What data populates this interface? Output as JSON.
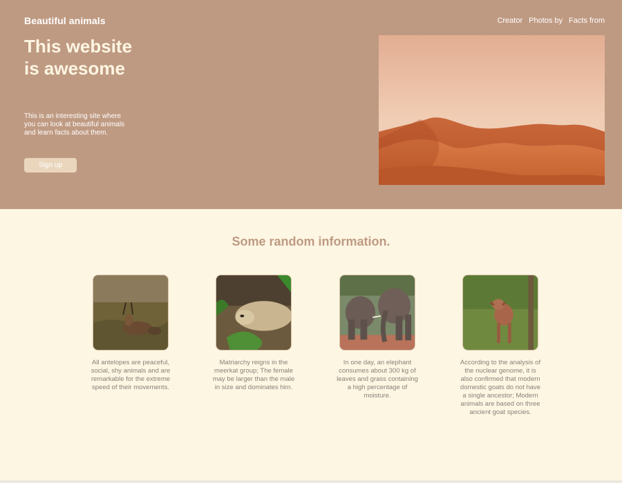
{
  "header": {
    "brand": "Beautiful animals",
    "nav": [
      "Creator",
      "Photos by",
      "Facts from"
    ]
  },
  "hero": {
    "headline": "This website is awesome",
    "description": "This is an interesting site where you can look at beautiful animals and learn facts about them.",
    "signup_label": "Sign up",
    "image_icon": "desert-dunes-photo"
  },
  "info": {
    "title": "Some random information.",
    "cards": [
      {
        "image_icon": "antelope-photo",
        "text": "All antelopes are peaceful, social, shy animals and are remarkable for the extreme speed of their movements."
      },
      {
        "image_icon": "meerkat-photo",
        "text": "Matriarchy reigns in the meerkat group; The female may be larger than the male in size and dominates him."
      },
      {
        "image_icon": "elephant-photo",
        "text": "In one day, an elephant consumes about 300 kg of leaves and grass containing a high percentage of moisture."
      },
      {
        "image_icon": "goat-photo",
        "text": "According to the analysis of the nuclear genome, it is also confirmed that modern domestic goats do not have a single ancestor; Modern animals are based on three ancient goat species."
      }
    ]
  },
  "colors": {
    "hero_bg": "#bf9a82",
    "page_bg": "#fdf6e3",
    "accent": "#bf9a82",
    "button_bg": "#ead6bd",
    "body_text": "#8a7f78"
  }
}
